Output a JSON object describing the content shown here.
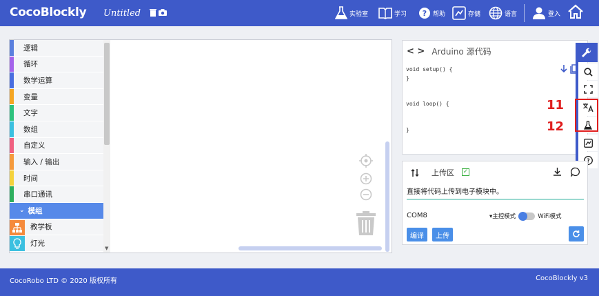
{
  "header": {
    "logo": "CocoBlockly",
    "project_title": "Untitled",
    "nav": [
      {
        "label": "实验室",
        "icon": "flask-icon"
      },
      {
        "label": "学习",
        "icon": "book-icon"
      },
      {
        "label": "帮助",
        "icon": "help-icon"
      },
      {
        "label": "存储",
        "icon": "save-icon"
      },
      {
        "label": "语言",
        "icon": "globe-icon"
      },
      {
        "label": "登入",
        "icon": "user-icon"
      }
    ]
  },
  "toolbox": {
    "categories": [
      {
        "label": "逻辑",
        "color": "#5b80de"
      },
      {
        "label": "循环",
        "color": "#a463ea"
      },
      {
        "label": "数学运算",
        "color": "#4a6ee0"
      },
      {
        "label": "变量",
        "color": "#f5a623"
      },
      {
        "label": "文字",
        "color": "#2ec27e"
      },
      {
        "label": "数组",
        "color": "#3cc0e0"
      },
      {
        "label": "自定义",
        "color": "#f06080"
      },
      {
        "label": "输入 / 输出",
        "color": "#f59a3c"
      },
      {
        "label": "时间",
        "color": "#f5d23c"
      },
      {
        "label": "串口通讯",
        "color": "#2eaf5e"
      }
    ],
    "selected": "模组",
    "sub_items": [
      {
        "label": "教学板",
        "color": "#f58a3c"
      },
      {
        "label": "灯光",
        "color": "#3cc0e0"
      }
    ]
  },
  "code_panel": {
    "arrows": "< >",
    "title": "Arduino 源代码",
    "code": "void setup() {\n}\n\n\nvoid loop() {\n\n\n}"
  },
  "annotations": {
    "n11": "11",
    "n12": "12"
  },
  "upload_panel": {
    "title": "上传区",
    "message": "直接将代码上传到电子模块中。",
    "port": "COM8",
    "mode_main": "▾主控模式",
    "mode_wifi": "WiFi模式",
    "compile_label": "编译",
    "upload_label": "上传"
  },
  "footer": {
    "copyright": "CocoRobo LTD © 2020 版权所有",
    "version": "CocoBlockly v3"
  }
}
